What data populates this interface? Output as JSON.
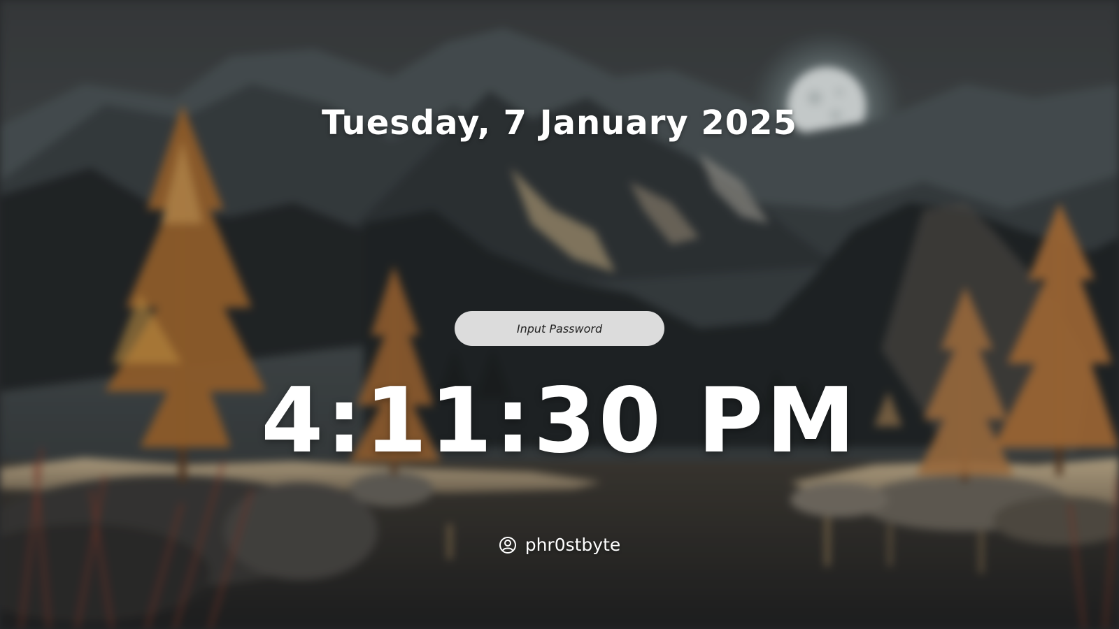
{
  "lock_screen": {
    "date": "Tuesday, 7 January 2025",
    "time": "4:11:30 PM",
    "password_placeholder": "Input Password",
    "username": "phr0stbyte",
    "user_icon": "user-circle-icon"
  },
  "colors": {
    "text": "#ffffff",
    "input_background": "#dcdcdc",
    "input_text": "#222222"
  }
}
